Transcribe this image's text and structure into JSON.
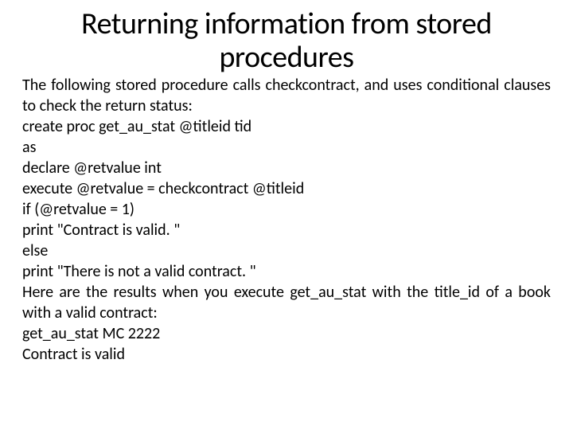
{
  "title": "Returning information from stored procedures",
  "intro": "The following stored procedure calls checkcontract, and uses conditional clauses to check the return status:",
  "code_lines": [
    "create proc get_au_stat @titleid tid",
    "as",
    "declare @retvalue int",
    "execute @retvalue = checkcontract @titleid",
    "if (@retvalue = 1)",
    "print \"Contract is valid. \"",
    "else",
    "print \"There is not a valid contract. \""
  ],
  "results_intro": "Here are the results when you execute get_au_stat with the title_id of a book with a valid contract:",
  "results_lines": [
    "get_au_stat MC 2222",
    "Contract is valid"
  ]
}
